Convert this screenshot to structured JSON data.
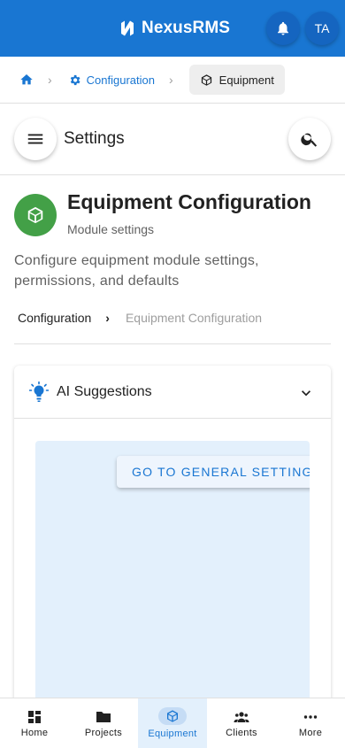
{
  "app": {
    "brand": "NexusRMS",
    "avatar_initials": "TA",
    "accent": "#1976d2"
  },
  "breadcrumb": {
    "parent": "Configuration",
    "current": "Equipment"
  },
  "header": {
    "title": "Settings"
  },
  "page": {
    "title": "Equipment Configuration",
    "subtitle": "Module settings",
    "description": "Configure equipment module settings, permissions, and defaults",
    "icon_color": "#43a047"
  },
  "sub_breadcrumb": {
    "first": "Configuration",
    "second": "Equipment Configuration"
  },
  "ai_card": {
    "title": "AI Suggestions",
    "action_label": "GO TO GENERAL SETTINGS"
  },
  "bottom_nav": [
    {
      "label": "Home",
      "icon": "grid-icon"
    },
    {
      "label": "Projects",
      "icon": "folder-icon"
    },
    {
      "label": "Equipment",
      "icon": "cube-icon",
      "active": true
    },
    {
      "label": "Clients",
      "icon": "people-icon"
    },
    {
      "label": "More",
      "icon": "more-icon"
    }
  ]
}
